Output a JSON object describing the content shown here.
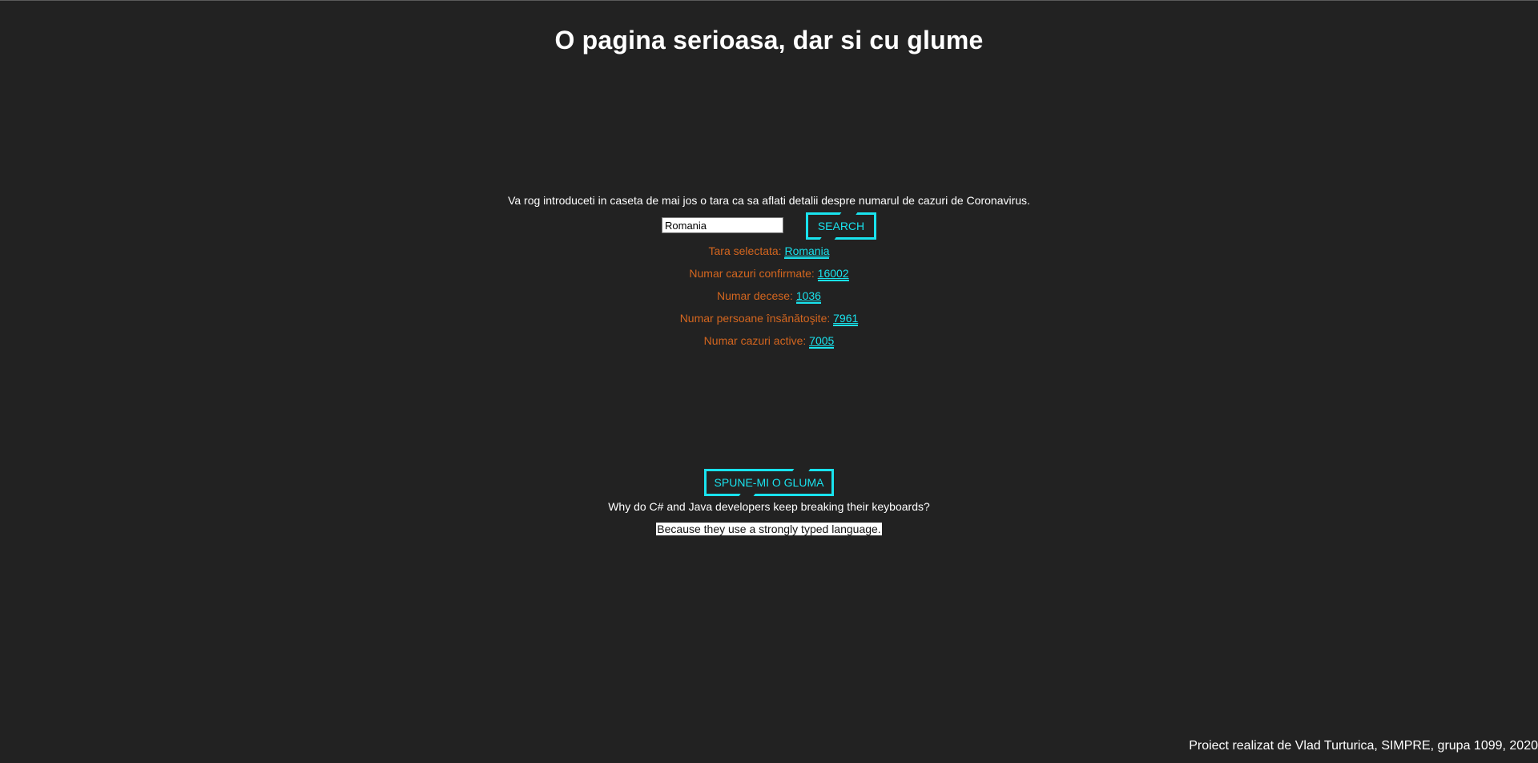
{
  "header": {
    "title": "O pagina serioasa, dar si cu glume"
  },
  "covid": {
    "intro": "Va rog introduceti in caseta de mai jos o tara ca sa aflati detalii despre numarul de cazuri de Coronavirus.",
    "search_value": "Romania",
    "search_label": "SEARCH",
    "stats": {
      "country_label": "Tara selectata: ",
      "country_value": "Romania",
      "confirmed_label": "Numar cazuri confirmate: ",
      "confirmed_value": "16002",
      "deaths_label": "Numar decese: ",
      "deaths_value": "1036",
      "recovered_label": "Numar persoane însănătoşite: ",
      "recovered_value": "7961",
      "active_label": "Numar cazuri active: ",
      "active_value": "7005"
    }
  },
  "jokes": {
    "button_label": "SPUNE-MI O GLUMA",
    "question": "Why do C# and Java developers keep breaking their keyboards?",
    "answer": "Because they use a strongly typed language."
  },
  "footer": {
    "credits": "Proiect realizat de Vlad Turturica, SIMPRE, grupa 1099, 2020"
  },
  "colors": {
    "background": "#222222",
    "accent": "#19e3ee",
    "label": "#d4661f"
  }
}
